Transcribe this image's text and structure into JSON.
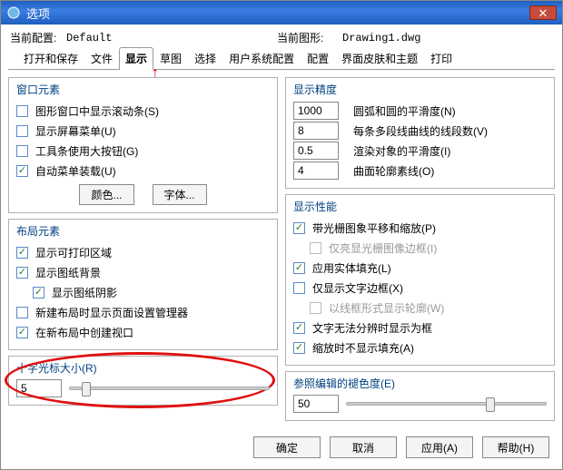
{
  "window": {
    "title": "选项"
  },
  "header": {
    "config_label": "当前配置:",
    "config_value": "Default",
    "drawing_label": "当前图形:",
    "drawing_value": "Drawing1.dwg"
  },
  "tabs": [
    "打开和保存",
    "文件",
    "显示",
    "草图",
    "选择",
    "用户系统配置",
    "配置",
    "界面皮肤和主题",
    "打印"
  ],
  "active_tab": 2,
  "left": {
    "window_elements": {
      "title": "窗口元素",
      "scrollbar": "图形窗口中显示滚动条(S)",
      "screenmenu": "显示屏幕菜单(U)",
      "bigbuttons": "工具条使用大按钮(G)",
      "autoload": "自动菜单装载(U)",
      "colors_btn": "颜色...",
      "fonts_btn": "字体..."
    },
    "layout_elements": {
      "title": "布局元素",
      "printable": "显示可打印区域",
      "paperbg": "显示图纸背景",
      "shadow": "显示图纸阴影",
      "pagesetup": "新建布局时显示页面设置管理器",
      "viewport": "在新布局中创建视口"
    },
    "crosshair": {
      "title": "十字光标大小(R)",
      "value": "5"
    }
  },
  "right": {
    "precision": {
      "title": "显示精度",
      "arc_val": "1000",
      "arc_lbl": "圆弧和圆的平滑度(N)",
      "seg_val": "8",
      "seg_lbl": "每条多段线曲线的线段数(V)",
      "render_val": "0.5",
      "render_lbl": "渲染对象的平滑度(I)",
      "surf_val": "4",
      "surf_lbl": "曲面轮廓素线(O)"
    },
    "performance": {
      "title": "显示性能",
      "panzoom": "带光栅图象平移和缩放(P)",
      "highlight": "仅亮显光栅图像边框(I)",
      "solidfill": "应用实体填充(L)",
      "textframe": "仅显示文字边框(X)",
      "wireframe": "以线框形式显示轮廓(W)",
      "frameonly": "文字无法分辨时显示为框",
      "nofillzoom": "缩放时不显示填充(A)"
    },
    "fade": {
      "title": "参照编辑的褪色度(E)",
      "value": "50"
    }
  },
  "footer": {
    "ok": "确定",
    "cancel": "取消",
    "apply": "应用(A)",
    "help": "帮助(H)"
  }
}
